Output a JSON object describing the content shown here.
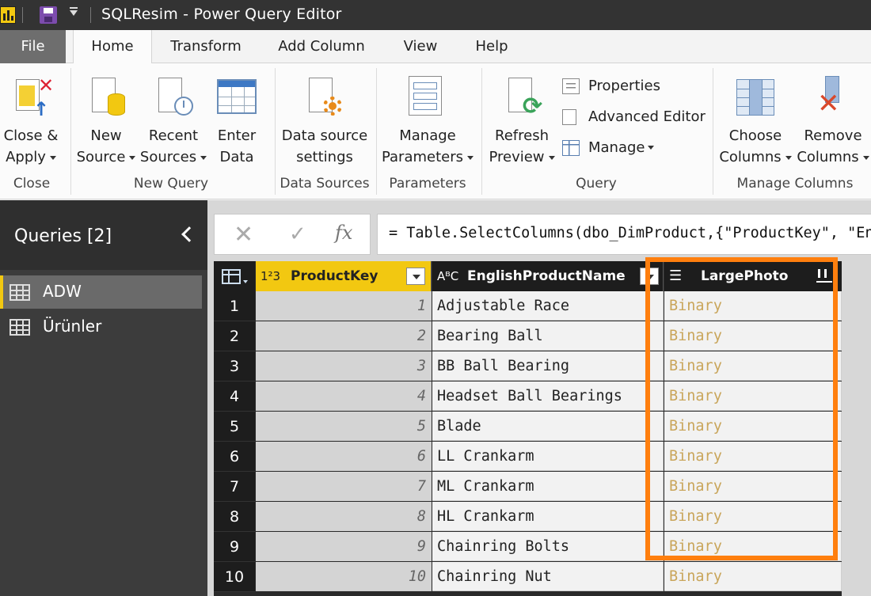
{
  "window": {
    "title": "SQLResim - Power Query Editor"
  },
  "tabs": [
    "File",
    "Home",
    "Transform",
    "Add Column",
    "View",
    "Help"
  ],
  "ribbon": {
    "close_apply": [
      "Close &",
      "Apply"
    ],
    "new_source": [
      "New",
      "Source"
    ],
    "recent_sources": [
      "Recent",
      "Sources"
    ],
    "enter_data": [
      "Enter",
      "Data"
    ],
    "data_source_settings": [
      "Data source",
      "settings"
    ],
    "manage_parameters": [
      "Manage",
      "Parameters"
    ],
    "refresh_preview": [
      "Refresh",
      "Preview"
    ],
    "properties": "Properties",
    "advanced_editor": "Advanced Editor",
    "manage": "Manage",
    "choose_columns": [
      "Choose",
      "Columns"
    ],
    "remove_columns": [
      "Remove",
      "Columns"
    ],
    "groups": [
      "Close",
      "New Query",
      "Data Sources",
      "Parameters",
      "Query",
      "Manage Columns"
    ]
  },
  "queries": {
    "title": "Queries [2]",
    "items": [
      "ADW",
      "Ürünler"
    ]
  },
  "formula_bar": {
    "fx": "fx",
    "formula": "= Table.SelectColumns(dbo_DimProduct,{\"ProductKey\", \"EnglishProductName\", \"LargePhoto\"})"
  },
  "grid": {
    "columns": [
      {
        "type_icon": "1²3",
        "label": "ProductKey"
      },
      {
        "type_icon": "AᴮC",
        "label": "EnglishProductName"
      },
      {
        "type_icon": "☰",
        "label": "LargePhoto"
      }
    ],
    "rows": [
      {
        "num": "1",
        "key": "1",
        "name": "Adjustable Race",
        "photo": "Binary"
      },
      {
        "num": "2",
        "key": "2",
        "name": "Bearing Ball",
        "photo": "Binary"
      },
      {
        "num": "3",
        "key": "3",
        "name": "BB Ball Bearing",
        "photo": "Binary"
      },
      {
        "num": "4",
        "key": "4",
        "name": "Headset Ball Bearings",
        "photo": "Binary"
      },
      {
        "num": "5",
        "key": "5",
        "name": "Blade",
        "photo": "Binary"
      },
      {
        "num": "6",
        "key": "6",
        "name": "LL Crankarm",
        "photo": "Binary"
      },
      {
        "num": "7",
        "key": "7",
        "name": "ML Crankarm",
        "photo": "Binary"
      },
      {
        "num": "8",
        "key": "8",
        "name": "HL Crankarm",
        "photo": "Binary"
      },
      {
        "num": "9",
        "key": "9",
        "name": "Chainring Bolts",
        "photo": "Binary"
      },
      {
        "num": "10",
        "key": "10",
        "name": "Chainring Nut",
        "photo": "Binary"
      }
    ]
  },
  "colors": {
    "highlight": "#ff7f0e",
    "accent": "#f2c811",
    "binary_text": "#c9a55a"
  }
}
